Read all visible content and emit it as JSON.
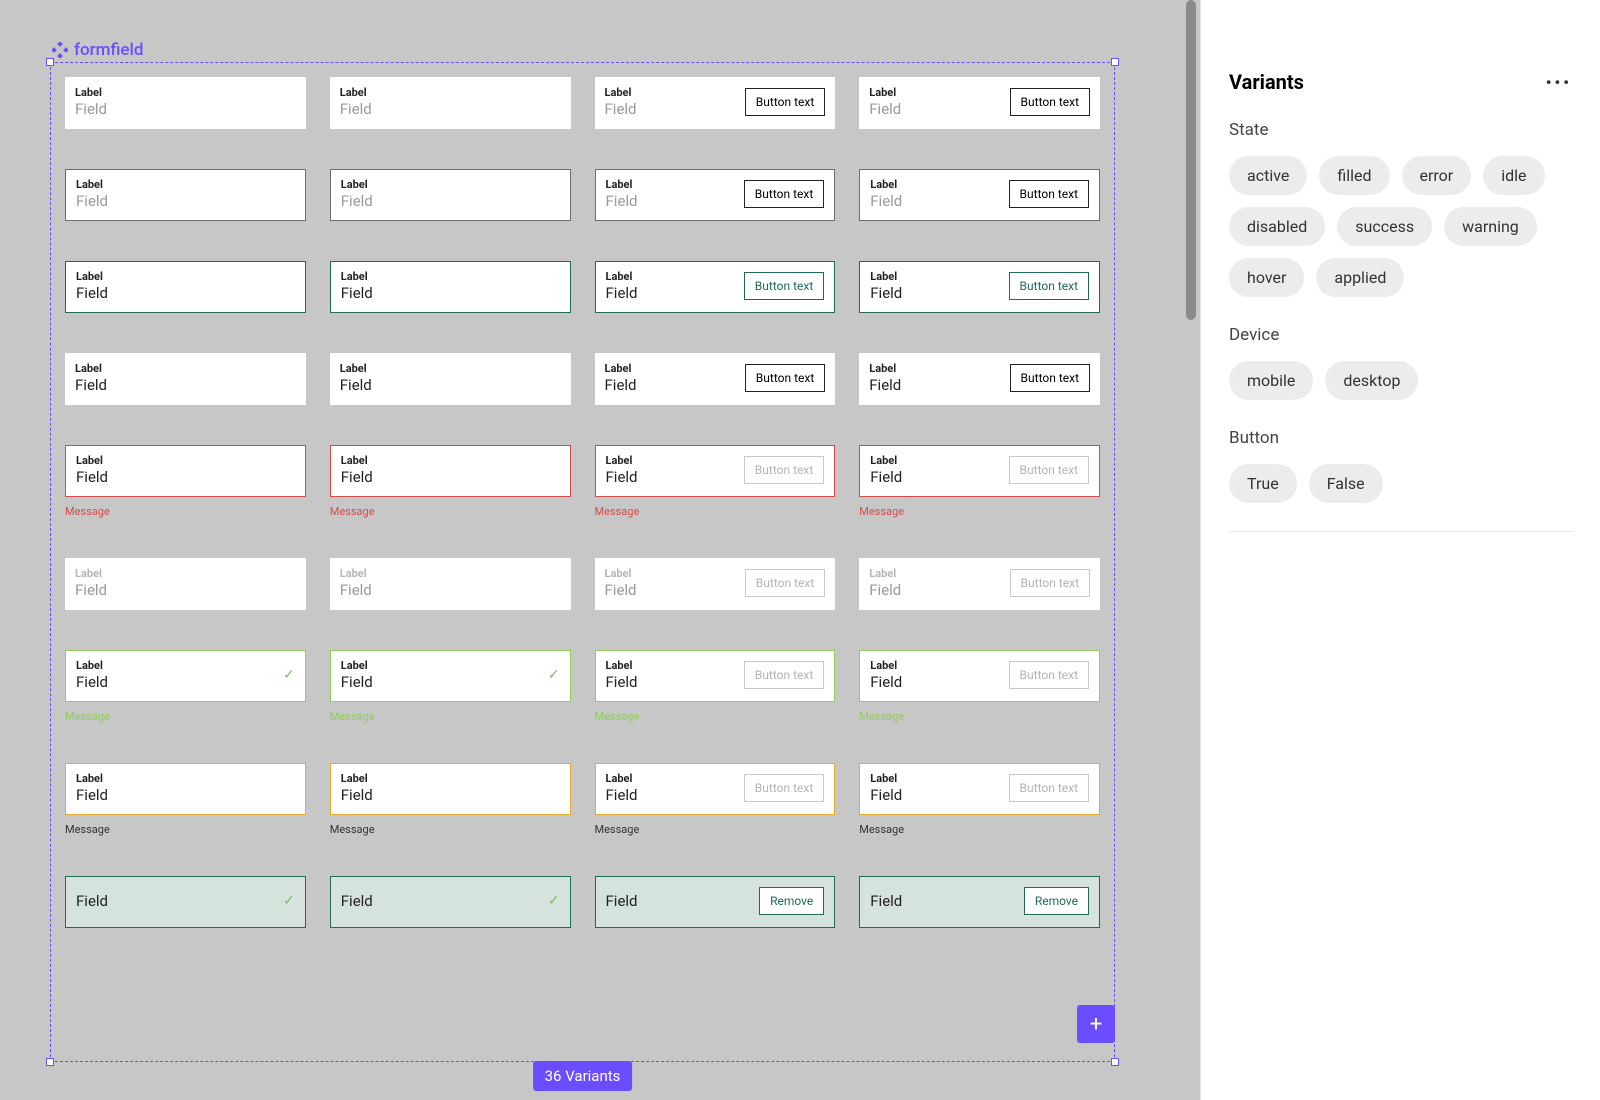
{
  "component": {
    "name": "formfield"
  },
  "variantCountLabel": "36 Variants",
  "field": {
    "label": "Label",
    "placeholder": "Field",
    "value": "Field",
    "buttonText": "Button text",
    "removeText": "Remove",
    "message": "Message"
  },
  "panel": {
    "title": "Variants",
    "sections": [
      {
        "title": "State",
        "options": [
          "active",
          "filled",
          "error",
          "idle",
          "disabled",
          "success",
          "warning",
          "hover",
          "applied"
        ]
      },
      {
        "title": "Device",
        "options": [
          "mobile",
          "desktop"
        ]
      },
      {
        "title": "Button",
        "options": [
          "True",
          "False"
        ]
      }
    ]
  },
  "rows": [
    {
      "border": "b-none",
      "placeholder": true,
      "btn": "normal",
      "msg": null
    },
    {
      "border": "b-dark",
      "placeholder": true,
      "btn": "normal",
      "msg": null
    },
    {
      "border": "b-green",
      "placeholder": false,
      "btn": "green",
      "msg": null
    },
    {
      "border": "b-none",
      "placeholder": false,
      "btn": "normal",
      "msg": null
    },
    {
      "border": "b-red",
      "placeholder": false,
      "btn": "disabled",
      "msg": "red"
    },
    {
      "border": "b-none",
      "placeholder": true,
      "btn": "disabled",
      "msg": null,
      "lblDisabled": true
    },
    {
      "border": "b-lime",
      "placeholder": false,
      "btn": "disabled",
      "msg": "lime",
      "check": true
    },
    {
      "border": "b-amber",
      "placeholder": false,
      "btn": "disabled",
      "msg": "dark"
    },
    {
      "border": "b-green",
      "placeholder": false,
      "btn": "remove",
      "msg": null,
      "bg": "bg-mint",
      "check": true,
      "noLabel": true
    }
  ]
}
